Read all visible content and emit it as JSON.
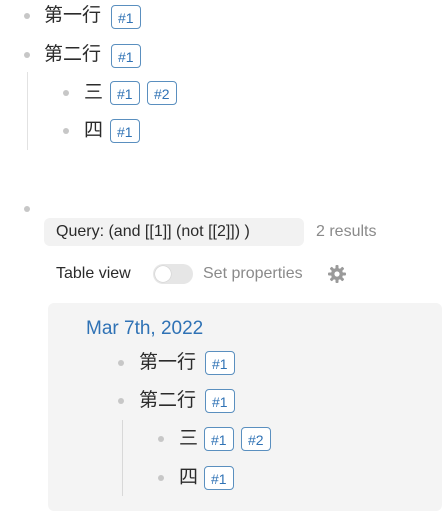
{
  "outline": {
    "items": [
      {
        "label": "第一行",
        "tags": [
          "#1"
        ]
      },
      {
        "label": "第二行",
        "tags": [
          "#1"
        ],
        "children": [
          {
            "label": "三",
            "tags": [
              "#1",
              "#2"
            ]
          },
          {
            "label": "四",
            "tags": [
              "#1"
            ]
          }
        ]
      }
    ]
  },
  "query": {
    "label": "Query: (and  [[1]] (not [[2]]) )",
    "results_count": "2 results",
    "table_view_label": "Table view",
    "table_view_enabled": false,
    "set_properties_label": "Set properties",
    "settings_icon": "gear-icon"
  },
  "results": {
    "page_title": "Mar 7th, 2022",
    "items": [
      {
        "label": "第一行",
        "tags": [
          "#1"
        ]
      },
      {
        "label": "第二行",
        "tags": [
          "#1"
        ],
        "children": [
          {
            "label": "三",
            "tags": [
              "#1",
              "#2"
            ]
          },
          {
            "label": "四",
            "tags": [
              "#1"
            ]
          }
        ]
      }
    ]
  },
  "colors": {
    "tag_border": "#5a8fbf",
    "tag_text": "#2f72b5",
    "link": "#2f72b5",
    "bullet": "#c7c7c7",
    "panel_bg": "#f4f4f4",
    "pill_bg": "#f2f2f2"
  }
}
